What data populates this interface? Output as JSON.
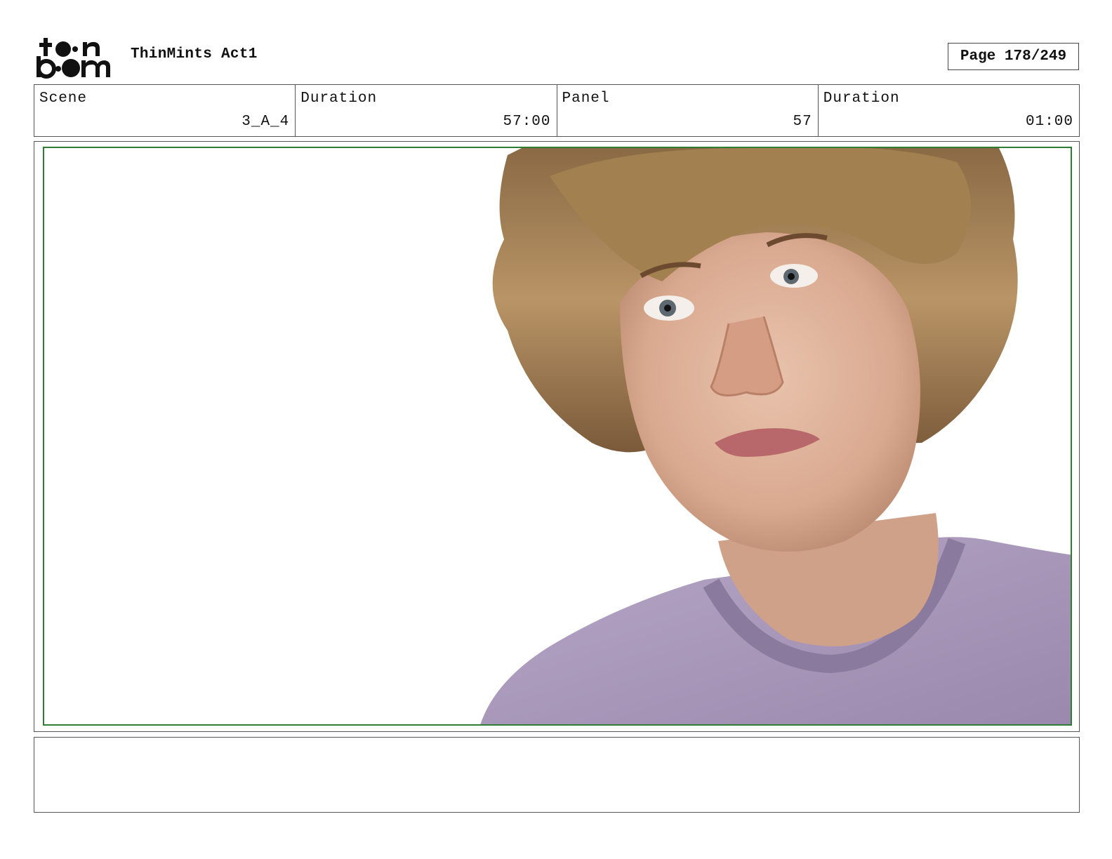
{
  "header": {
    "logo_text": "toon boom",
    "project_title": "ThinMints Act1",
    "page_label": "Page 178/249"
  },
  "info": {
    "scene_label": "Scene",
    "scene_value": "3_A_4",
    "scene_duration_label": "Duration",
    "scene_duration_value": "57:00",
    "panel_label": "Panel",
    "panel_value": "57",
    "panel_duration_label": "Duration",
    "panel_duration_value": "01:00"
  },
  "panel": {
    "frame_color": "#2e7d32"
  },
  "notes": {
    "text": ""
  }
}
